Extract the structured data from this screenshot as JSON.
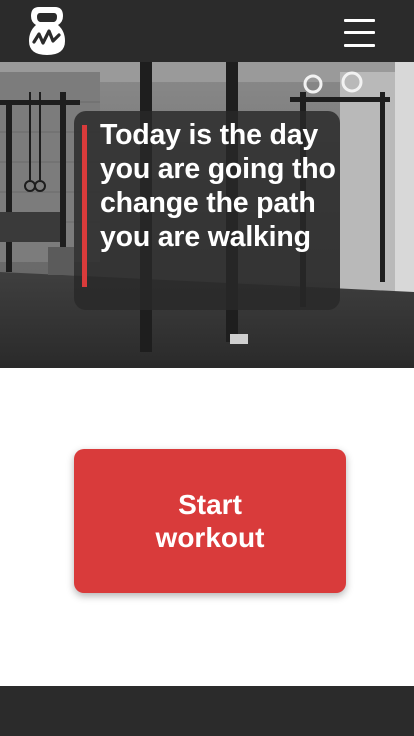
{
  "header": {
    "logo_icon": "kettlebell-logo-icon",
    "menu_icon": "hamburger-menu-icon"
  },
  "hero": {
    "quote": "Today is the day you are going tho change the path you are walking",
    "accent_color": "#d93b3b"
  },
  "main": {
    "start_button_label": "Start workout"
  },
  "colors": {
    "header_bg": "#2b2b2b",
    "footer_bg": "#2b2b2b",
    "accent": "#d93b3b"
  }
}
